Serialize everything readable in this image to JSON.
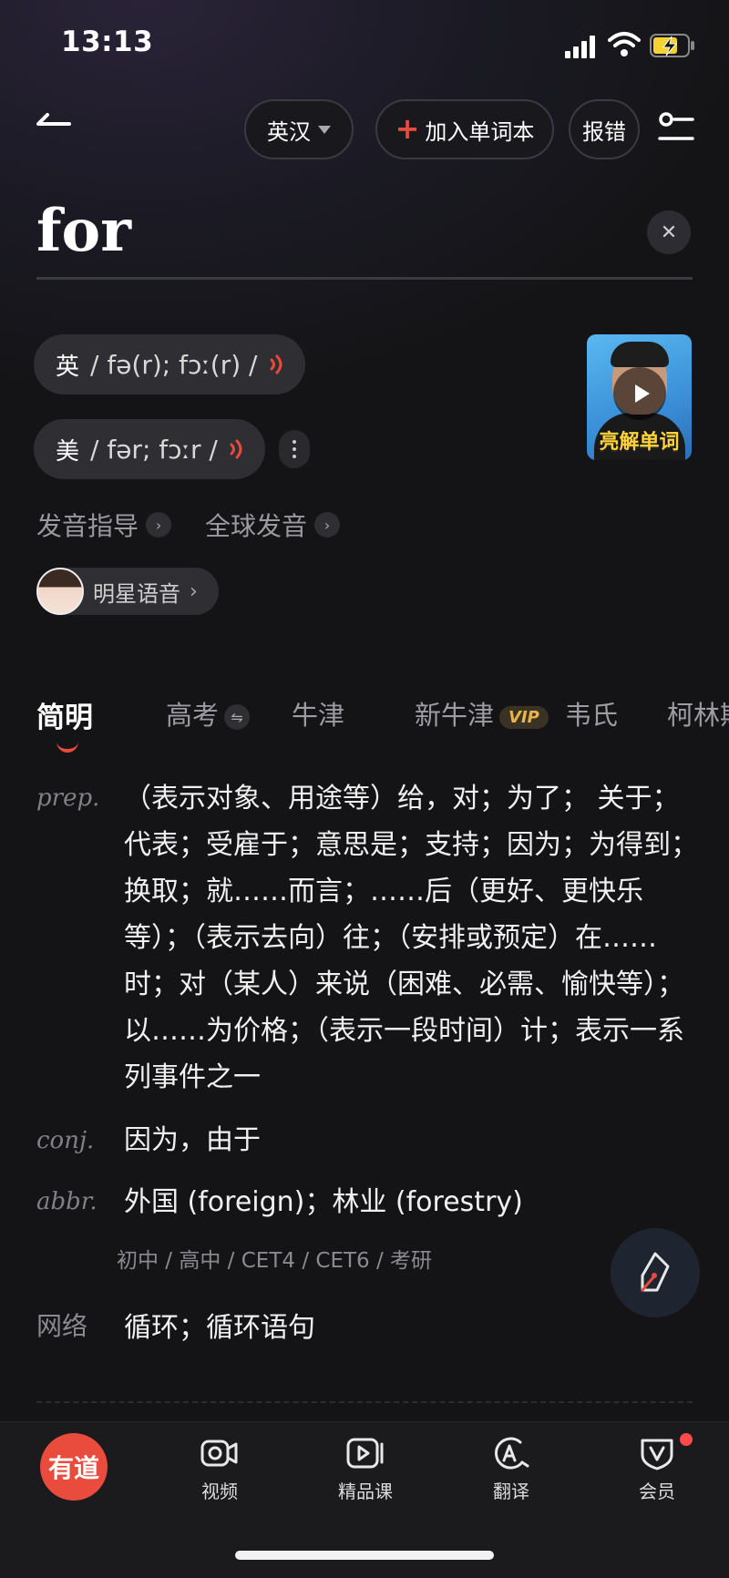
{
  "status_bar": {
    "time": "13:13"
  },
  "header": {
    "lang_label": "英汉",
    "add_label": "加入单词本",
    "report_label": "报错"
  },
  "search": {
    "word": "for"
  },
  "pronunciation": {
    "uk": {
      "label": "英",
      "ipa": "/ fə(r); fɔː(r) /"
    },
    "us": {
      "label": "美",
      "ipa": "/ fər; fɔːr /"
    },
    "video_caption": "亮解单词"
  },
  "links": {
    "guide": "发音指导",
    "global": "全球发音",
    "celebrity": "明星语音"
  },
  "tabs": [
    {
      "label": "简明"
    },
    {
      "label": "高考"
    },
    {
      "label": "牛津"
    },
    {
      "label": "新牛津"
    },
    {
      "label": "韦氏"
    },
    {
      "label": "柯林斯"
    }
  ],
  "vip_badge": "VIP",
  "definitions": [
    {
      "pos": "prep.",
      "text": "（表示对象、用途等）给，对；为了； 关于；代表；受雇于；意思是；支持；因为；为得到；换取；就……而言；……后（更好、更快乐等）；（表示去向）往；（安排或预定）在……时；对（某人）来说（困难、必需、愉快等）；以……为价格；（表示一段时间）计；表示一系列事件之一"
    },
    {
      "pos": "conj.",
      "text": "因为，由于"
    },
    {
      "pos": "abbr.",
      "text": "外国 (foreign)；林业 (forestry)"
    }
  ],
  "level_tags": "初中 / 高中 / CET4 / CET6 / 考研",
  "network": {
    "label": "网络",
    "text": "循环；循环语句"
  },
  "bottom_nav": {
    "logo": "有道",
    "items": [
      {
        "label": "视频",
        "icon": "video-camera-icon"
      },
      {
        "label": "精品课",
        "icon": "course-play-icon"
      },
      {
        "label": "翻译",
        "icon": "translate-icon"
      },
      {
        "label": "会员",
        "icon": "vip-shield-icon"
      }
    ]
  },
  "colors": {
    "accent": "#e84a3c",
    "background": "#141416",
    "vip_gold": "#e8b44a"
  }
}
